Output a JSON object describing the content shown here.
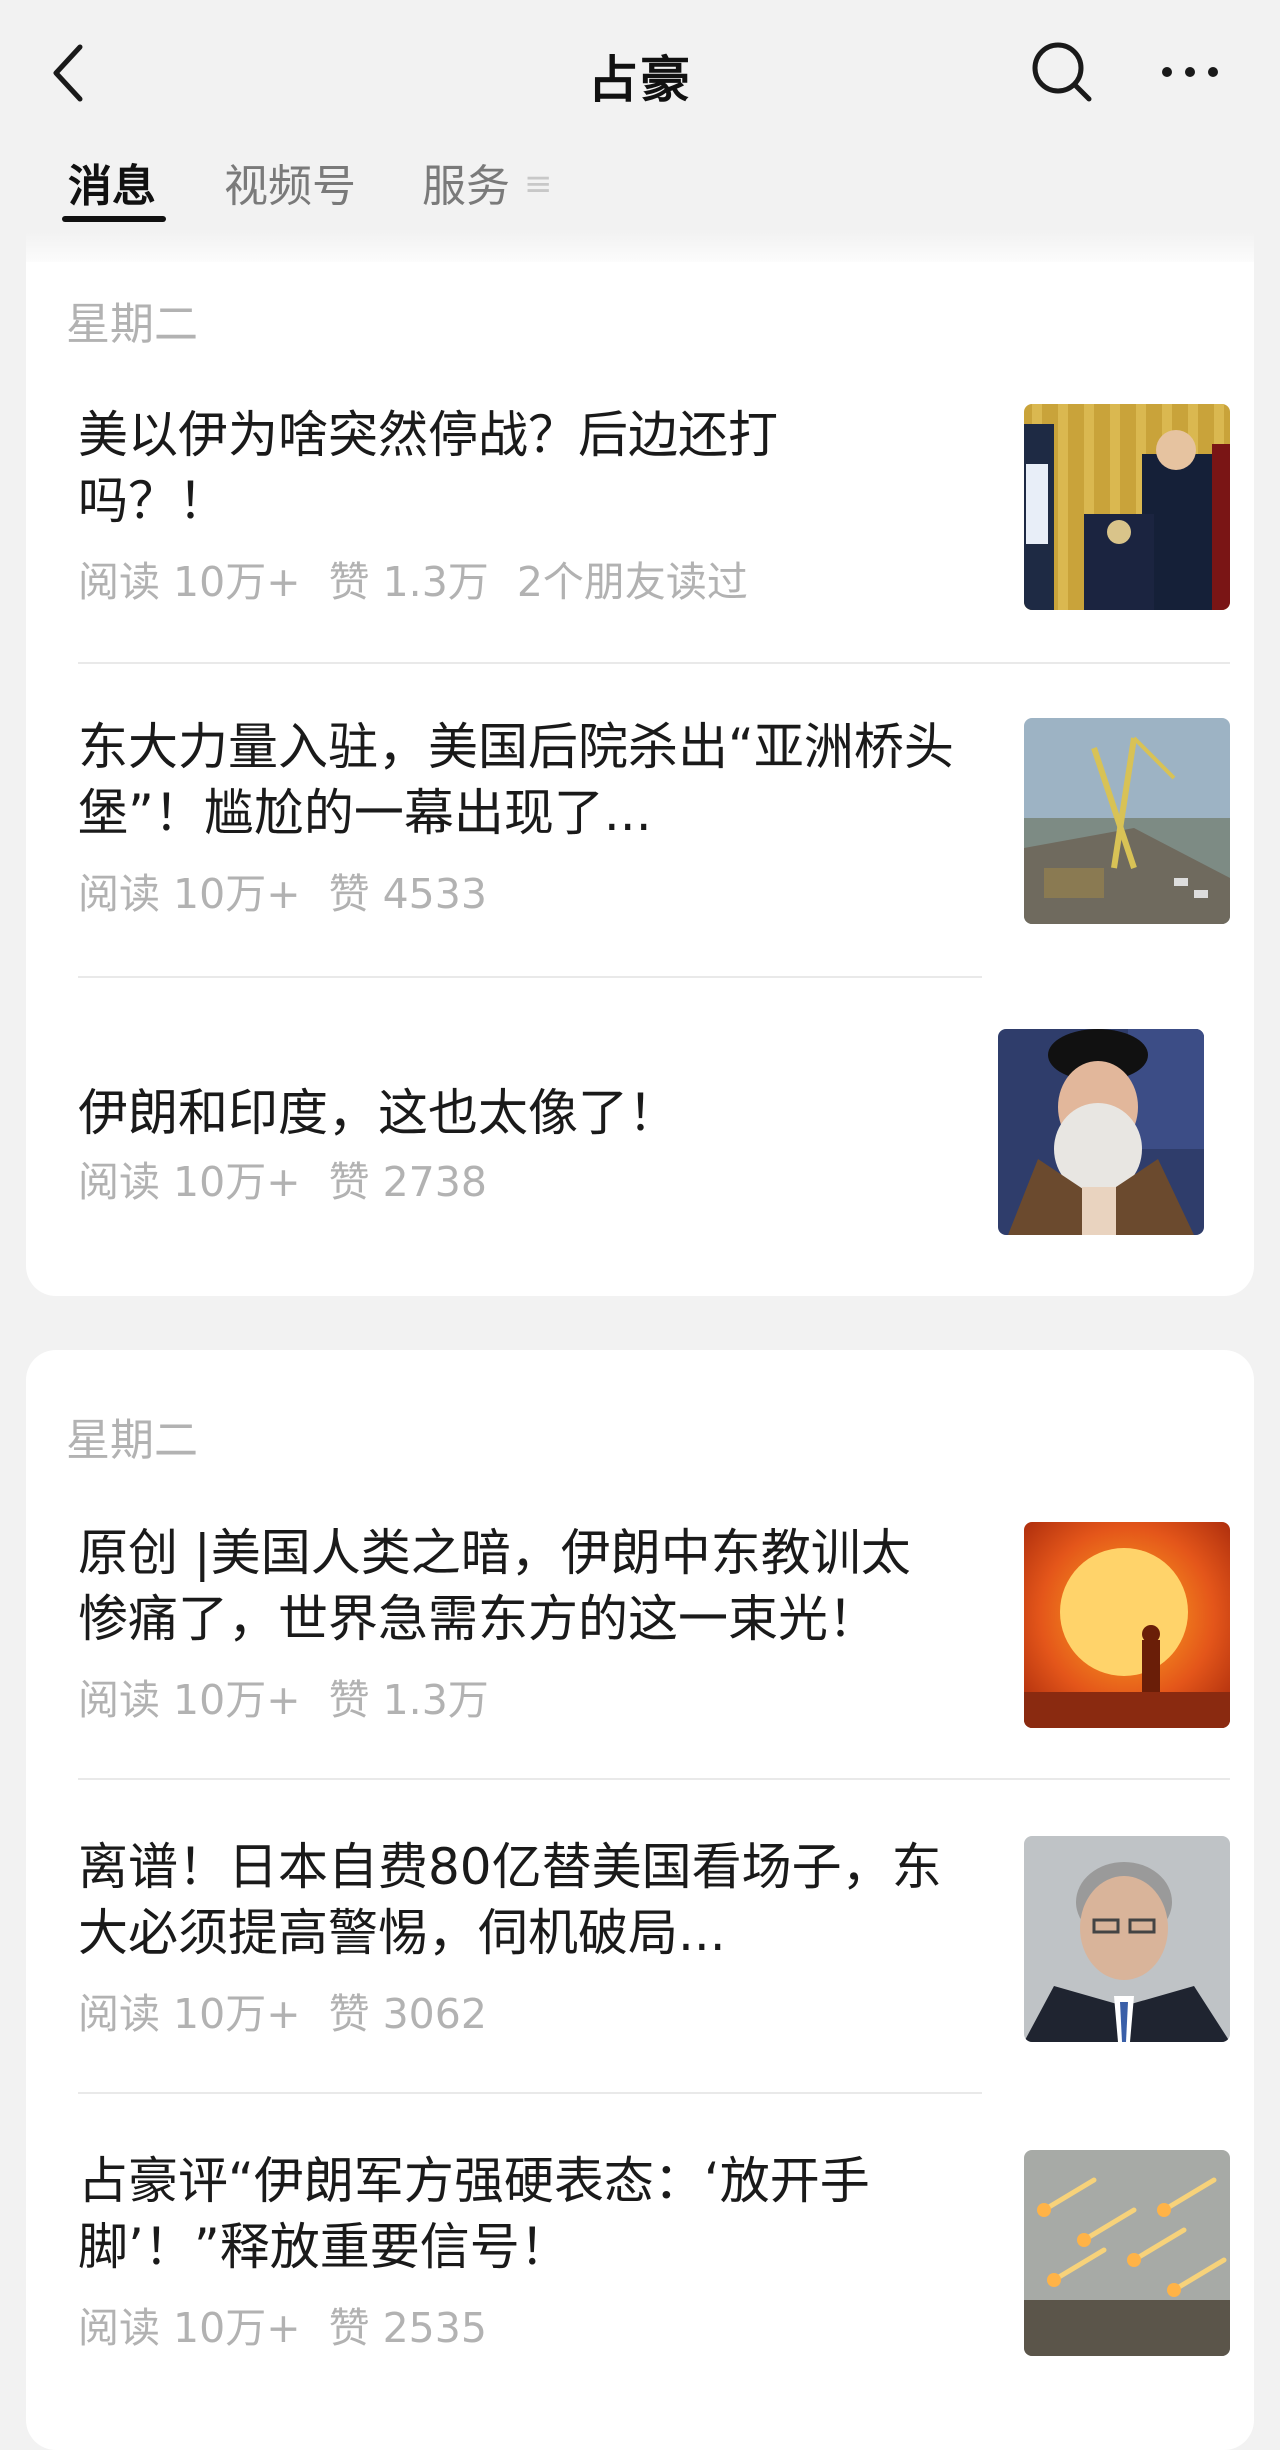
{
  "header": {
    "title": "占豪",
    "back_icon": "chevron-left-icon",
    "search_icon": "search-icon",
    "more_icon": "more-horizontal-icon"
  },
  "tabs": [
    {
      "label": "消息",
      "active": true
    },
    {
      "label": "视频号",
      "active": false
    },
    {
      "label": "服务",
      "active": false
    }
  ],
  "groups": [
    {
      "day": "星期二",
      "articles": [
        {
          "title": "美以伊为啥突然停战？后边还打吗？！",
          "reads": "阅读 10万+",
          "likes": "赞 1.3万",
          "friends": "2个朋友读过",
          "thumb": "podium-photo"
        },
        {
          "title": "东大力量入驻，美国后院杀出“亚洲桥头堡”！尴尬的一幕出现了...",
          "reads": "阅读 10万+",
          "likes": "赞 4533",
          "thumb": "port-crane-photo"
        },
        {
          "title": "伊朗和印度，这也太像了！",
          "reads": "阅读 10万+",
          "likes": "赞 2738",
          "thumb": "cleric-portrait-photo"
        }
      ]
    },
    {
      "day": "星期二",
      "articles": [
        {
          "title": "原创 |美国人类之暗，伊朗中东教训太惨痛了，世界急需东方的这一束光！",
          "reads": "阅读 10万+",
          "likes": "赞 1.3万",
          "thumb": "sunset-photo"
        },
        {
          "title": "离谱！日本自费80亿替美国看场子，东大必须提高警惕，伺机破局...",
          "reads": "阅读 10万+",
          "likes": "赞 3062",
          "thumb": "politician-portrait-photo"
        },
        {
          "title": "占豪评“伊朗军方强硬表态：‘放开手脚’！”释放重要信号！",
          "reads": "阅读 10万+",
          "likes": "赞 2535",
          "thumb": "rocket-launch-photo"
        }
      ]
    }
  ],
  "colors": {
    "background": "#f2f2f2",
    "card": "#ffffff",
    "text": "#1a1a1a",
    "muted": "#b2b2b2",
    "tab_inactive": "#7a7a7a"
  }
}
